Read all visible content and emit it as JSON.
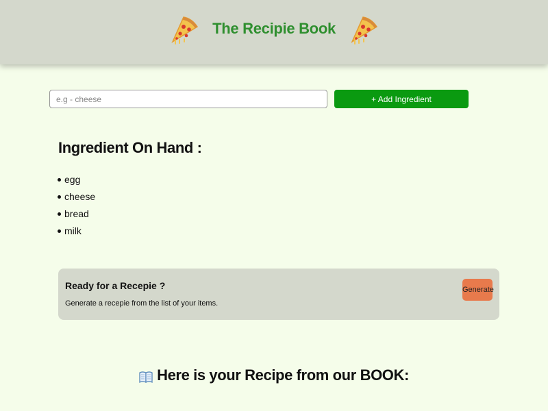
{
  "header": {
    "title": "The Recipie Book",
    "left_icon": "pizza-icon",
    "right_icon": "pizza-icon"
  },
  "form": {
    "input_placeholder": "e.g - cheese",
    "input_value": "",
    "add_button_label": "+ Add Ingredient"
  },
  "ingredients": {
    "heading": "Ingredient On Hand :",
    "items": [
      "egg",
      "cheese",
      "bread",
      "milk"
    ]
  },
  "recipe_card": {
    "title": "Ready for a Recepie ?",
    "description": "Generate a recepie from the list of your items.",
    "button_label": "Generate"
  },
  "result": {
    "icon": "book-icon",
    "heading": "Here is your Recipe from our BOOK:"
  },
  "colors": {
    "page_background": "#f5fdea",
    "header_background": "#d4d8cc",
    "title_green": "#2f8f2f",
    "add_button": "#0a9a10",
    "generate_button": "#e87a4c",
    "card_background": "#d4d8cc"
  }
}
